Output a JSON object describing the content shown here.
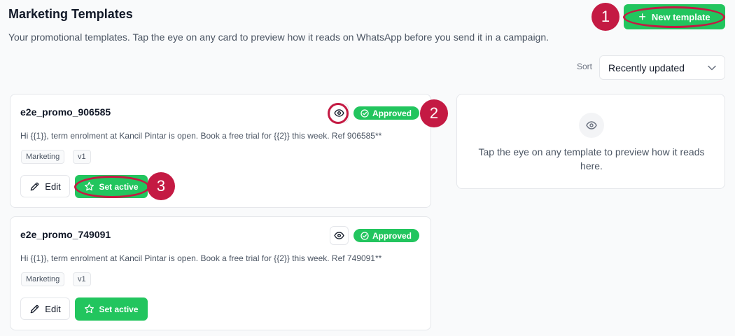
{
  "header": {
    "title": "Marketing Templates",
    "subtitle": "Your promotional templates. Tap the eye on any card to preview how it reads on WhatsApp before you send it in a campaign."
  },
  "actions": {
    "new_template_label": "New template"
  },
  "sort": {
    "label": "Sort",
    "value": "Recently updated"
  },
  "templates": [
    {
      "name": "e2e_promo_906585",
      "status": "Approved",
      "body": "Hi {{1}}, term enrolment at Kancil Pintar is open. Book a free trial for {{2}} this week. Ref 906585**",
      "category": "Marketing",
      "version": "v1",
      "edit_label": "Edit",
      "activate_label": "Set active"
    },
    {
      "name": "e2e_promo_749091",
      "status": "Approved",
      "body": "Hi {{1}}, term enrolment at Kancil Pintar is open. Book a free trial for {{2}} this week. Ref 749091**",
      "category": "Marketing",
      "version": "v1",
      "edit_label": "Edit",
      "activate_label": "Set active"
    }
  ],
  "preview": {
    "empty_text": "Tap the eye on any template to preview how it reads here.",
    "icon": "eye-icon"
  },
  "annotations": [
    "1",
    "2",
    "3"
  ],
  "colors": {
    "accent": "#22c55e",
    "annotation": "#c41a43",
    "text_primary": "#111827",
    "text_muted": "#4b5563"
  }
}
